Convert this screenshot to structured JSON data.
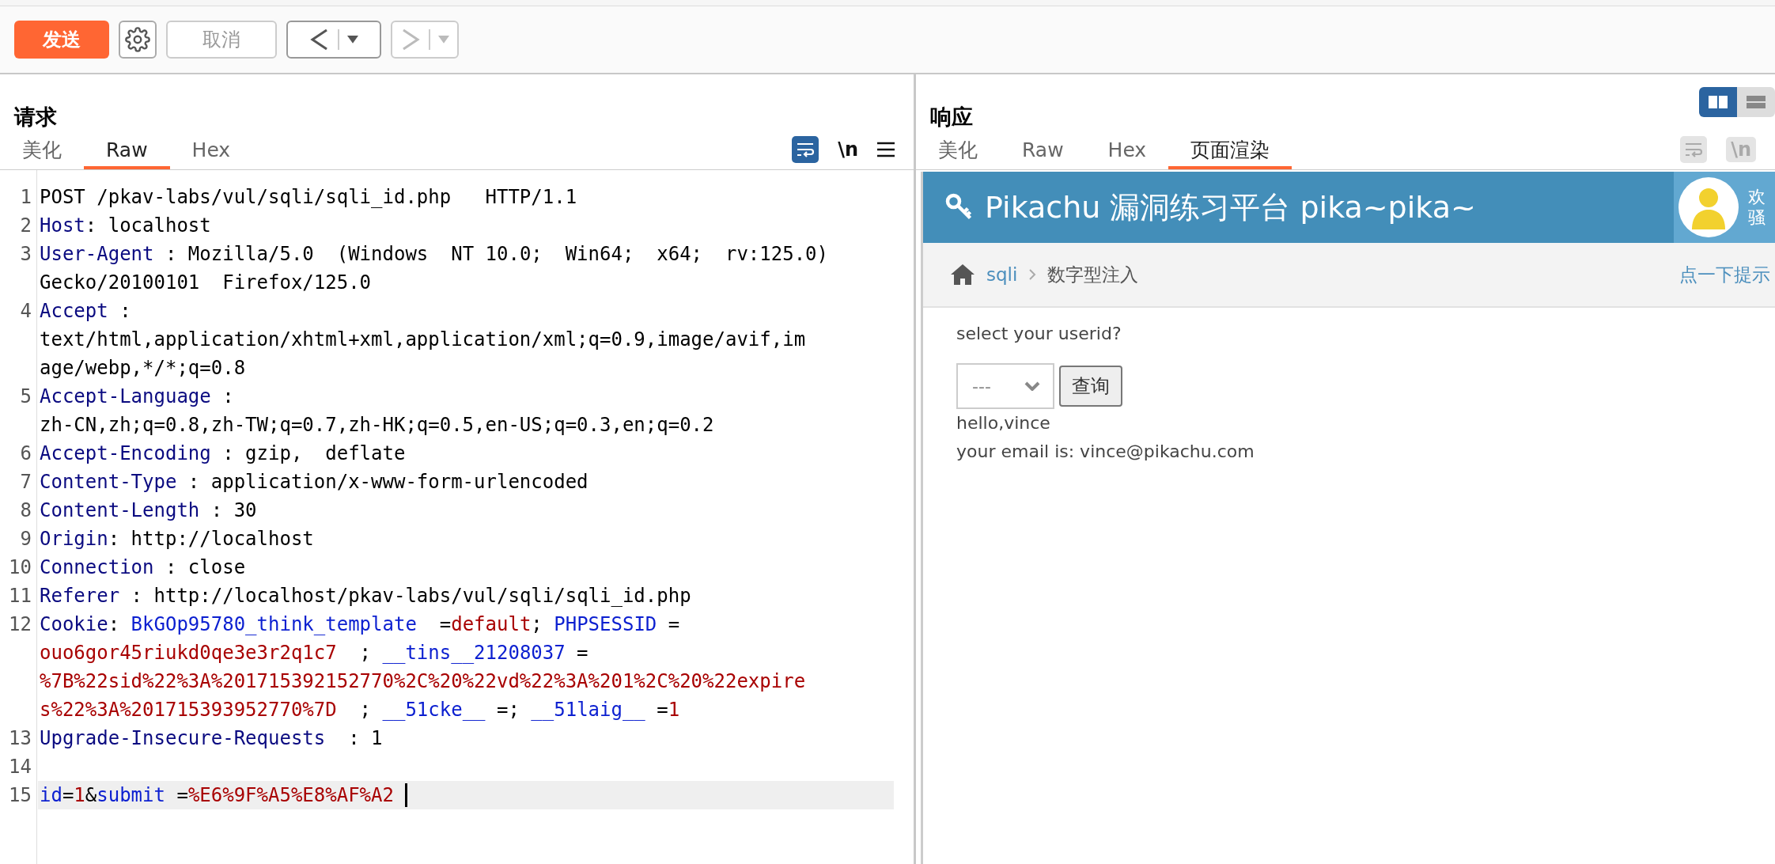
{
  "toolbar": {
    "buttons": [
      {
        "kind": "send",
        "label": "发送"
      },
      {
        "kind": "settings"
      },
      {
        "kind": "cancel",
        "label": "取消",
        "disabled": true
      },
      {
        "kind": "back",
        "disabled": false
      },
      {
        "kind": "forward",
        "disabled": true
      }
    ]
  },
  "request": {
    "title": "请求",
    "tabs": [
      {
        "label": "美化",
        "selected": false
      },
      {
        "label": "Raw",
        "selected": true
      },
      {
        "label": "Hex",
        "selected": false
      }
    ],
    "tools": {
      "wrap": true,
      "newline_label": "\\n",
      "enabled": true
    },
    "lines": [
      {
        "number": "1",
        "current": false,
        "wraps": [
          {
            "tokens": [
              {
                "kind": "text",
                "text": "POST /pkav-labs/vul/sqli/sqli_id.php   HTTP/1.1"
              }
            ]
          }
        ]
      },
      {
        "number": "2",
        "current": false,
        "wraps": [
          {
            "tokens": [
              {
                "kind": "header",
                "text": "Host"
              },
              {
                "kind": "text",
                "text": ": localhost"
              }
            ]
          }
        ]
      },
      {
        "number": "3",
        "current": false,
        "wraps": [
          {
            "tokens": [
              {
                "kind": "header",
                "text": "User-Agent"
              },
              {
                "kind": "text",
                "text": " : Mozilla/5.0  (Windows  NT 10.0;  Win64;  x64;  rv:125.0)"
              }
            ]
          },
          {
            "tokens": [
              {
                "kind": "text",
                "text": "Gecko/20100101  Firefox/125.0"
              }
            ]
          }
        ]
      },
      {
        "number": "4",
        "current": false,
        "wraps": [
          {
            "tokens": [
              {
                "kind": "header",
                "text": "Accept"
              },
              {
                "kind": "text",
                "text": " :"
              }
            ]
          },
          {
            "tokens": [
              {
                "kind": "text",
                "text": "text/html,application/xhtml+xml,application/xml;q=0.9,image/avif,im"
              }
            ]
          },
          {
            "tokens": [
              {
                "kind": "text",
                "text": "age/webp,*/*;q=0.8"
              }
            ]
          }
        ]
      },
      {
        "number": "5",
        "current": false,
        "wraps": [
          {
            "tokens": [
              {
                "kind": "header",
                "text": "Accept-Language"
              },
              {
                "kind": "text",
                "text": " :"
              }
            ]
          },
          {
            "tokens": [
              {
                "kind": "text",
                "text": "zh-CN,zh;q=0.8,zh-TW;q=0.7,zh-HK;q=0.5,en-US;q=0.3,en;q=0.2"
              }
            ]
          }
        ]
      },
      {
        "number": "6",
        "current": false,
        "wraps": [
          {
            "tokens": [
              {
                "kind": "header",
                "text": "Accept-Encoding"
              },
              {
                "kind": "text",
                "text": " : gzip,  deflate"
              }
            ]
          }
        ]
      },
      {
        "number": "7",
        "current": false,
        "wraps": [
          {
            "tokens": [
              {
                "kind": "header",
                "text": "Content-Type"
              },
              {
                "kind": "text",
                "text": " : application/x-www-form-urlencoded"
              }
            ]
          }
        ]
      },
      {
        "number": "8",
        "current": false,
        "wraps": [
          {
            "tokens": [
              {
                "kind": "header",
                "text": "Content-Length"
              },
              {
                "kind": "text",
                "text": " : 30"
              }
            ]
          }
        ]
      },
      {
        "number": "9",
        "current": false,
        "wraps": [
          {
            "tokens": [
              {
                "kind": "header",
                "text": "Origin"
              },
              {
                "kind": "text",
                "text": ": http://localhost"
              }
            ]
          }
        ]
      },
      {
        "number": "10",
        "current": false,
        "wraps": [
          {
            "tokens": [
              {
                "kind": "header",
                "text": "Connection"
              },
              {
                "kind": "text",
                "text": " : close"
              }
            ]
          }
        ]
      },
      {
        "number": "11",
        "current": false,
        "wraps": [
          {
            "tokens": [
              {
                "kind": "header",
                "text": "Referer"
              },
              {
                "kind": "text",
                "text": " : http://localhost/pkav-labs/vul/sqli/sqli_id.php"
              }
            ]
          }
        ]
      },
      {
        "number": "12",
        "current": false,
        "wraps": [
          {
            "tokens": [
              {
                "kind": "header",
                "text": "Cookie"
              },
              {
                "kind": "text",
                "text": ": "
              },
              {
                "kind": "name",
                "text": "BkGOp95780_think_template"
              },
              {
                "kind": "text",
                "text": "  ="
              },
              {
                "kind": "value",
                "text": "default"
              },
              {
                "kind": "text",
                "text": "; "
              },
              {
                "kind": "name",
                "text": "PHPSESSID"
              },
              {
                "kind": "text",
                "text": " ="
              }
            ]
          },
          {
            "tokens": [
              {
                "kind": "value",
                "text": "ouo6gor45riukd0qe3e3r2q1c7"
              },
              {
                "kind": "text",
                "text": "  ; "
              },
              {
                "kind": "name",
                "text": "__tins__21208037"
              },
              {
                "kind": "text",
                "text": " ="
              }
            ]
          },
          {
            "tokens": [
              {
                "kind": "value",
                "text": "%7B%22sid%22%3A%201715392152770%2C%20%22vd%22%3A%201%2C%20%22expire"
              }
            ]
          },
          {
            "tokens": [
              {
                "kind": "value",
                "text": "s%22%3A%201715393952770%7D"
              },
              {
                "kind": "text",
                "text": "  ; "
              },
              {
                "kind": "name",
                "text": "__51cke__"
              },
              {
                "kind": "text",
                "text": " =; "
              },
              {
                "kind": "name",
                "text": "__51laig__"
              },
              {
                "kind": "text",
                "text": " ="
              },
              {
                "kind": "value",
                "text": "1"
              }
            ]
          }
        ]
      },
      {
        "number": "13",
        "current": false,
        "wraps": [
          {
            "tokens": [
              {
                "kind": "header",
                "text": "Upgrade-Insecure-Requests"
              },
              {
                "kind": "text",
                "text": "  : 1"
              }
            ]
          }
        ]
      },
      {
        "number": "14",
        "current": false
      },
      {
        "number": "15",
        "current": true,
        "wraps": [
          {
            "tokens": [
              {
                "kind": "name",
                "text": "id"
              },
              {
                "kind": "text",
                "text": "="
              },
              {
                "kind": "value",
                "text": "1"
              },
              {
                "kind": "text",
                "text": "&"
              },
              {
                "kind": "name",
                "text": "submit"
              },
              {
                "kind": "text",
                "text": " ="
              },
              {
                "kind": "value",
                "text": "%E6%9F%A5%E8%AF%A2"
              }
            ]
          }
        ]
      }
    ]
  },
  "response": {
    "title": "响应",
    "layout_toggle": [
      {
        "kind": "split",
        "selected": true
      },
      {
        "kind": "stacked",
        "selected": false
      }
    ],
    "tabs": [
      {
        "label": "美化",
        "selected": false
      },
      {
        "label": "Raw",
        "selected": false
      },
      {
        "label": "Hex",
        "selected": false
      },
      {
        "label": "页面渲染",
        "selected": true
      }
    ],
    "tools": {
      "wrap": false,
      "newline_label": "\\n",
      "enabled": false
    },
    "render": {
      "banner": {
        "title": "Pikachu 漏洞练习平台 pika~pika~",
        "greeting": [
          "欢",
          "骚"
        ]
      },
      "breadcrumb": {
        "items": [
          "sqli",
          "数字型注入"
        ],
        "hint": "点一下提示"
      },
      "prompt": "select your userid?",
      "select": {
        "value": "---"
      },
      "query_button": "查询",
      "result": [
        "hello,vince",
        "your email is: vince@pikachu.com"
      ]
    }
  }
}
